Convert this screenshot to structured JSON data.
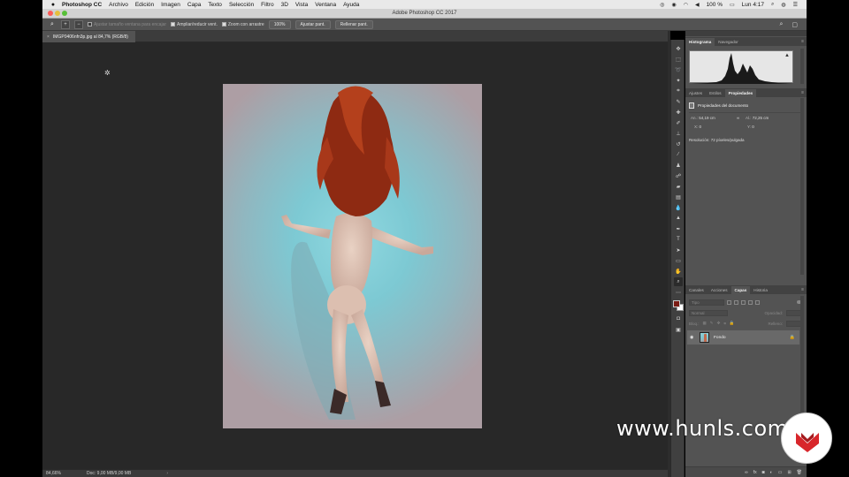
{
  "menubar": {
    "app_name": "Photoshop CC",
    "items": [
      "Archivo",
      "Edición",
      "Imagen",
      "Capa",
      "Texto",
      "Selección",
      "Filtro",
      "3D",
      "Vista",
      "Ventana",
      "Ayuda"
    ],
    "battery": "100 %",
    "clock": "Lun 4:17"
  },
  "titlebar": {
    "title": "Adobe Photoshop CC 2017"
  },
  "options": {
    "resize_windows": "Ajustar tamaño ventana para encajar",
    "zoom_all": "Ampliar/reducir vent.",
    "scrubby": "Zoom con arrastre",
    "zoom_value": "100%",
    "fit_screen": "Ajustar pant.",
    "fill_screen": "Rellenar pant."
  },
  "document": {
    "tab_title": "IMGP0406nfn3p.jpg al 84,7% (RGB/8)"
  },
  "statusbar": {
    "zoom": "84,66%",
    "doc_info": "Doc: 9,00 MB/9,00 MB"
  },
  "panels": {
    "top_tabs": [
      "Histograma",
      "Navegador"
    ],
    "mid_tabs": [
      "Ajustes",
      "Estilos",
      "Propiedades"
    ],
    "props_title": "Propiedades del documento",
    "width_label": "An.:",
    "width_value": "54,19 cm",
    "height_label": "Al.:",
    "height_value": "72,25 cm",
    "x_label": "X:",
    "x_value": "0",
    "y_label": "Y:",
    "y_value": "0",
    "resolution": "Resolución: 72 píxeles/pulgada",
    "layer_tabs": [
      "Canales",
      "Acciones",
      "Capas",
      "Historia"
    ],
    "filter_kind": "Tipo",
    "blend_mode": "Normal",
    "opacity_label": "Opacidad:",
    "lock_label": "Bloq.:",
    "fill_label": "Relleno:",
    "layer_name": "Fondo"
  },
  "watermark": {
    "text": "www.hunls.com"
  },
  "colors": {
    "foreground": "#7a1c14",
    "background": "#ffffff",
    "canvas": "#282828",
    "panel": "#535353"
  },
  "icons": [
    "apple-icon",
    "zoom-tool-icon",
    "search-icon",
    "eye-icon",
    "lock-icon",
    "trash-icon",
    "new-layer-icon",
    "folder-icon",
    "fx-icon",
    "mask-icon",
    "link-icon"
  ]
}
